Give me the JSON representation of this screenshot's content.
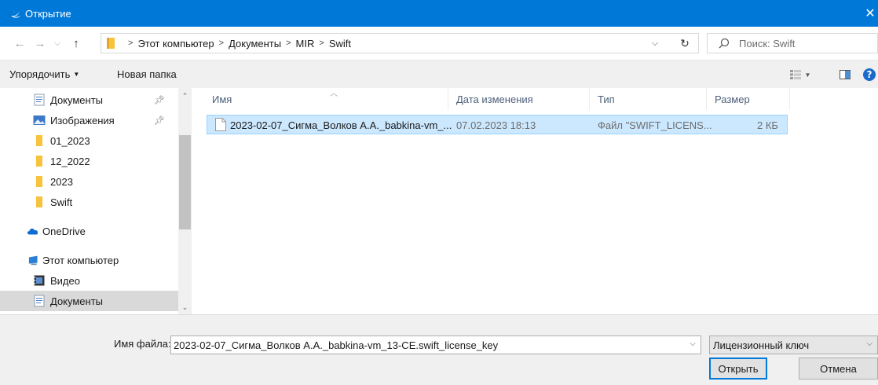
{
  "window": {
    "title": "Открытие"
  },
  "address": {
    "breadcrumbs": [
      "Этот компьютер",
      "Документы",
      "MIR",
      "Swift"
    ]
  },
  "search": {
    "placeholder": "Поиск: Swift"
  },
  "toolbar": {
    "organize_label": "Упорядочить",
    "new_folder_label": "Новая папка"
  },
  "sidebar": {
    "items": [
      {
        "label": "Документы",
        "icon": "documents-icon",
        "pinned": true
      },
      {
        "label": "Изображения",
        "icon": "pictures-icon",
        "pinned": true
      },
      {
        "label": "01_2023",
        "icon": "folder-icon"
      },
      {
        "label": "12_2022",
        "icon": "folder-icon"
      },
      {
        "label": "2023",
        "icon": "folder-icon"
      },
      {
        "label": "Swift",
        "icon": "folder-icon"
      },
      {
        "label": "OneDrive",
        "icon": "onedrive-icon"
      },
      {
        "label": "Этот компьютер",
        "icon": "computer-icon"
      },
      {
        "label": "Видео",
        "icon": "video-icon"
      },
      {
        "label": "Документы",
        "icon": "documents-icon",
        "selected": true
      }
    ]
  },
  "columns": {
    "name": "Имя",
    "date": "Дата изменения",
    "type": "Тип",
    "size": "Размер"
  },
  "files": [
    {
      "name": "2023-02-07_Сигма_Волков А.А._babkina-vm_...",
      "date": "07.02.2023 18:13",
      "type": "Файл \"SWIFT_LICENS...",
      "size": "2 КБ",
      "selected": true
    }
  ],
  "bottom": {
    "filename_label": "Имя файла:",
    "filename_value": "2023-02-07_Сигма_Волков А.А._babkina-vm_13-CE.swift_license_key",
    "filetype_value": "Лицензионный ключ",
    "open_label": "Открыть",
    "cancel_label": "Отмена"
  },
  "colors": {
    "titlebar": "#0078d7",
    "selection": "#cce8ff",
    "selection_border": "#99d1ff",
    "folder": "#f8c33c"
  }
}
